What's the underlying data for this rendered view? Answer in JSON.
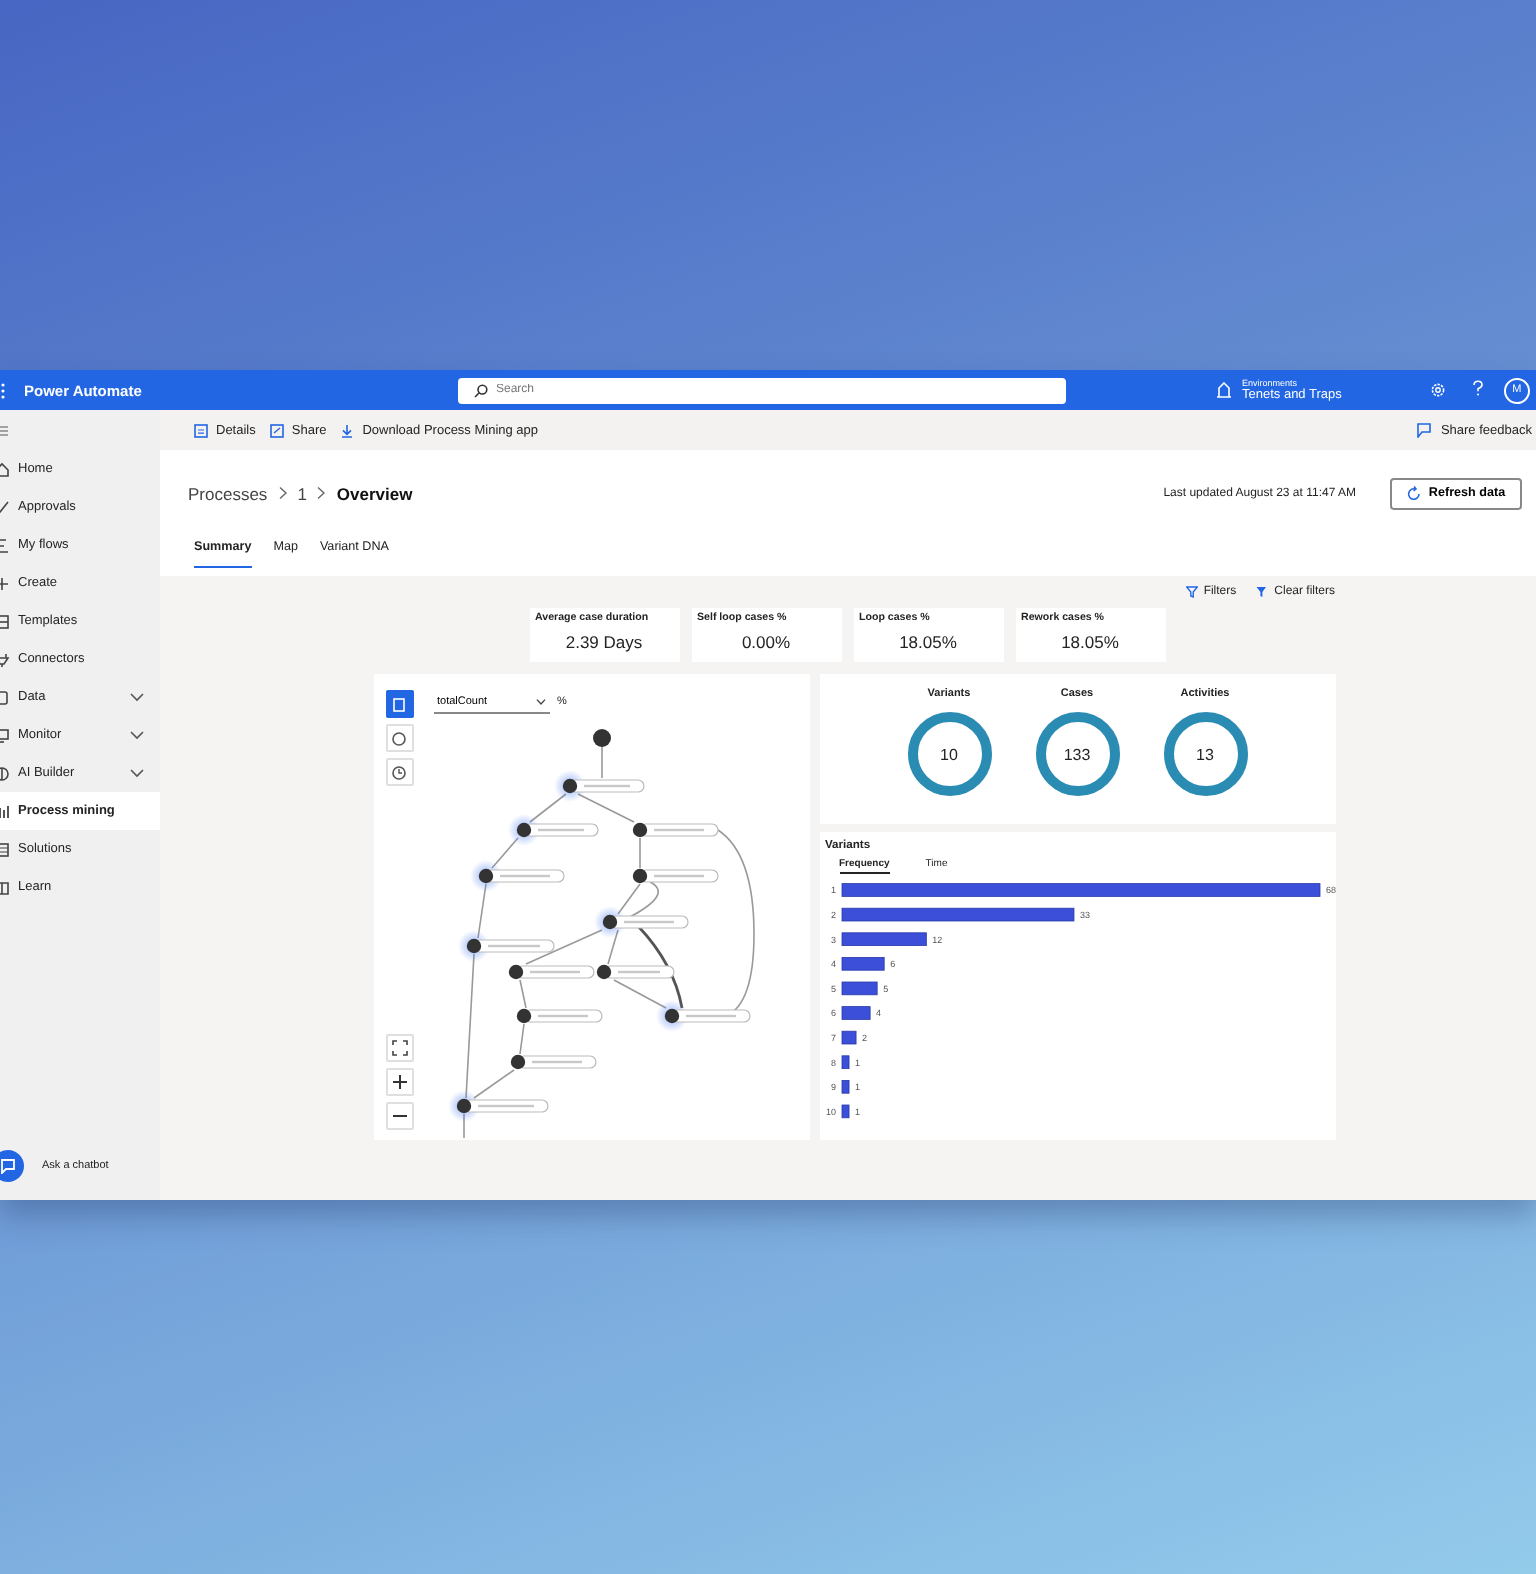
{
  "app": {
    "title": "Power Automate"
  },
  "search": {
    "placeholder": "Search"
  },
  "environment": {
    "label": "Environments",
    "name": "Tenets and Traps"
  },
  "avatar": {
    "initials": "M"
  },
  "commands": [
    {
      "label": "Details"
    },
    {
      "label": "Share"
    },
    {
      "label": "Download Process Mining app"
    }
  ],
  "feedback": "Share feedback",
  "nav": [
    {
      "label": "Home",
      "selected": false,
      "has_children": false
    },
    {
      "label": "Approvals",
      "selected": false,
      "has_children": false
    },
    {
      "label": "My flows",
      "selected": false,
      "has_children": false
    },
    {
      "label": "Create",
      "selected": false,
      "has_children": false
    },
    {
      "label": "Templates",
      "selected": false,
      "has_children": false
    },
    {
      "label": "Connectors",
      "selected": false,
      "has_children": false
    },
    {
      "label": "Data",
      "selected": false,
      "has_children": true
    },
    {
      "label": "Monitor",
      "selected": false,
      "has_children": true
    },
    {
      "label": "AI Builder",
      "selected": false,
      "has_children": true
    },
    {
      "label": "Process mining",
      "selected": true,
      "has_children": false
    },
    {
      "label": "Solutions",
      "selected": false,
      "has_children": false
    },
    {
      "label": "Learn",
      "selected": false,
      "has_children": false
    }
  ],
  "chatbot": "Ask a chatbot",
  "breadcrumb": [
    "Processes",
    "1",
    "Overview"
  ],
  "last_updated": "Last updated August 23 at 11:47 AM",
  "refresh_button": "Refresh data",
  "tabs": [
    {
      "label": "Summary",
      "selected": true
    },
    {
      "label": "Map",
      "selected": false
    },
    {
      "label": "Variant DNA",
      "selected": false
    }
  ],
  "filters": {
    "filters": "Filters",
    "clear": "Clear filters"
  },
  "metrics": [
    {
      "label": "Average case duration",
      "value": "2.39 Days"
    },
    {
      "label": "Self loop cases %",
      "value": "0.00%"
    },
    {
      "label": "Loop cases %",
      "value": "18.05%"
    },
    {
      "label": "Rework cases %",
      "value": "18.05%"
    }
  ],
  "map": {
    "measure": "totalCount",
    "unit": "%",
    "view_buttons": [
      {
        "selected": true
      },
      {
        "selected": false
      },
      {
        "selected": false
      }
    ]
  },
  "counts": [
    {
      "label": "Variants",
      "value": "10"
    },
    {
      "label": "Cases",
      "value": "133"
    },
    {
      "label": "Activities",
      "value": "13"
    }
  ],
  "variants": {
    "title": "Variants",
    "tabs": [
      {
        "label": "Frequency",
        "selected": true
      },
      {
        "label": "Time",
        "selected": false
      }
    ],
    "chart_data": {
      "type": "bar",
      "orientation": "horizontal",
      "categories": [
        "1",
        "2",
        "3",
        "4",
        "5",
        "6",
        "7",
        "8",
        "9",
        "10"
      ],
      "series": [
        {
          "color": "#3b4fd8",
          "values": [
            68,
            33,
            12,
            6,
            5,
            4,
            2,
            1,
            1,
            1
          ]
        }
      ],
      "data_labels": true
    }
  }
}
